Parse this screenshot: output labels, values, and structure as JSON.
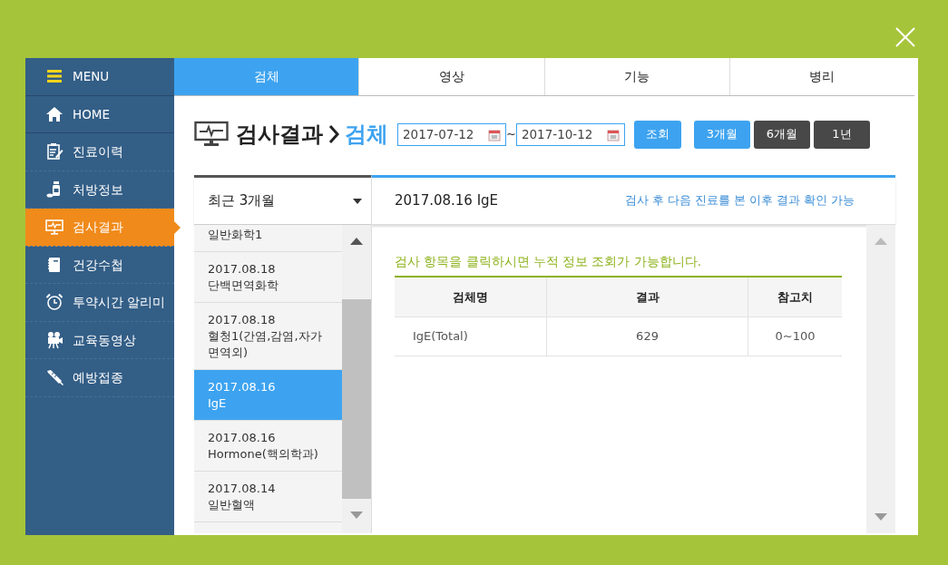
{
  "sidebar": {
    "menu_label": "MENU",
    "items": [
      {
        "label": "HOME",
        "kind": "home",
        "selected": false
      },
      {
        "label": "진료이력",
        "kind": "clipboard",
        "selected": false
      },
      {
        "label": "처방정보",
        "kind": "pill",
        "selected": false
      },
      {
        "label": "검사결과",
        "kind": "monitor",
        "selected": true
      },
      {
        "label": "건강수첩",
        "kind": "notebook",
        "selected": false
      },
      {
        "label": "투약시간 알리미",
        "kind": "alarm",
        "selected": false
      },
      {
        "label": "교육동영상",
        "kind": "camera",
        "selected": false
      },
      {
        "label": "예방접종",
        "kind": "syringe",
        "selected": false
      }
    ]
  },
  "tabs": [
    {
      "label": "검체",
      "selected": true
    },
    {
      "label": "영상",
      "selected": false
    },
    {
      "label": "기능",
      "selected": false
    },
    {
      "label": "병리",
      "selected": false
    }
  ],
  "page_title": "검사결과",
  "breadcrumb_current": "검체",
  "date_from": "2017-07-12",
  "date_separator": "~",
  "date_to": "2017-10-12",
  "search_button": "조회",
  "period_buttons": [
    {
      "label": "3개월",
      "selected": true
    },
    {
      "label": "6개월",
      "selected": false
    },
    {
      "label": "1년",
      "selected": false
    }
  ],
  "period_select": {
    "value": "최근 3개월"
  },
  "results_list": [
    {
      "name": "일반화학1",
      "selected": false
    },
    {
      "date": "2017.08.18",
      "name": "단백면역화학",
      "selected": false
    },
    {
      "date": "2017.08.18",
      "name": "혈청1(간염,감염,자가면역외)",
      "selected": false
    },
    {
      "date": "2017.08.16",
      "name": "IgE",
      "selected": true
    },
    {
      "date": "2017.08.16",
      "name": "Hormone(핵의학과)",
      "selected": false
    },
    {
      "date": "2017.08.14",
      "name": "일반혈액",
      "selected": false
    }
  ],
  "detail": {
    "title": "2017.08.16 IgE",
    "notice": "검사 후 다음 진료를 본 이후 결과 확인 가능",
    "hint": "검사 항목을 클릭하시면 누적 정보 조회가 가능합니다.",
    "table": {
      "columns": [
        "검체명",
        "결과",
        "참고치"
      ],
      "rows": [
        [
          "IgE(Total)",
          "629",
          "0~100"
        ]
      ]
    }
  }
}
